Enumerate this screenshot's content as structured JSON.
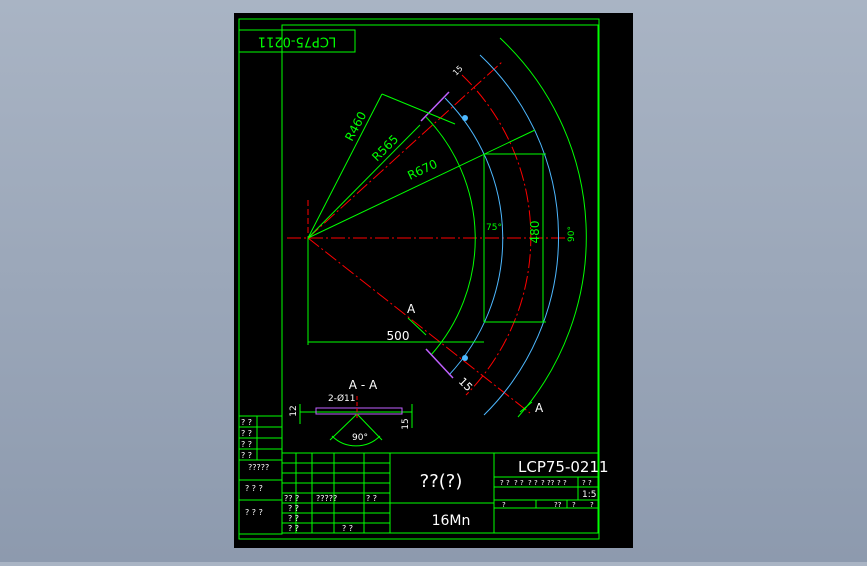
{
  "drawing": {
    "part_number_rotated": "LCP75-0211",
    "part_number": "LCP75-0211",
    "title": "??(?)",
    "material": "16Mn",
    "scale": "1:5"
  },
  "dimensions": {
    "r_inner": "R460",
    "r_mid": "R565",
    "r_outer": "R670",
    "height": "480",
    "width": "500",
    "angle_75": "75°",
    "angle_90": "90°",
    "thickness_top": "15",
    "thickness_bottom": "15",
    "section_mark_a1": "A",
    "section_mark_a2": "A"
  },
  "section_view": {
    "label": "A - A",
    "hole_note": "2-Ø11",
    "dim_left": "12",
    "dim_right": "15",
    "angle": "90°"
  },
  "title_block": {
    "left_cells": [
      "? ?",
      "? ?",
      "? ?",
      "? ?",
      "?????",
      "? ? ?",
      "? ? ?"
    ],
    "grid_cells": [
      "?? ?",
      "?????",
      "? ?",
      "? ?",
      "? ?",
      "? ?",
      "? ?"
    ],
    "info_row": [
      "? ?",
      "? ?",
      "? ?",
      "? ??",
      "? ?",
      "? ?"
    ],
    "bottom_row": [
      "?",
      "??",
      "?",
      "?"
    ]
  },
  "colors": {
    "background": "#000000",
    "border": "#00ff00",
    "center_line": "#ff0000",
    "dimension": "#00ff00",
    "blue_arc": "#4db8ff",
    "text": "#ffffff",
    "purple": "#c060ff"
  }
}
